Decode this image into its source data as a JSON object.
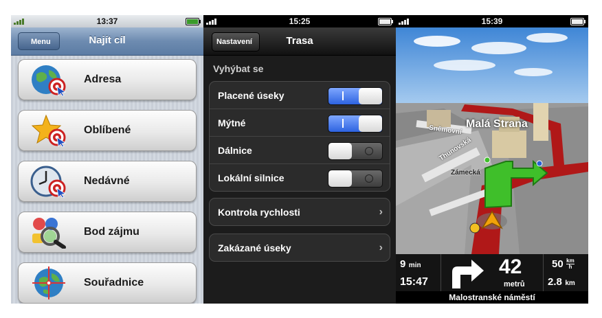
{
  "panel1": {
    "status_time": "13:37",
    "back_label": "Menu",
    "title": "Najít cíl",
    "items": [
      {
        "label": "Adresa",
        "icon": "globe-target-icon"
      },
      {
        "label": "Oblíbené",
        "icon": "star-target-icon"
      },
      {
        "label": "Nedávné",
        "icon": "clock-target-icon"
      },
      {
        "label": "Bod zájmu",
        "icon": "poi-magnifier-icon"
      },
      {
        "label": "Souřadnice",
        "icon": "globe-crosshair-icon"
      }
    ]
  },
  "panel2": {
    "status_time": "15:25",
    "back_label": "Nastavení",
    "title": "Trasa",
    "section": "Vyhýbat se",
    "toggles": [
      {
        "label": "Placené úseky",
        "state": "on"
      },
      {
        "label": "Mýtné",
        "state": "on"
      },
      {
        "label": "Dálnice",
        "state": "off"
      },
      {
        "label": "Lokální silnice",
        "state": "off"
      }
    ],
    "nav_rows": [
      {
        "label": "Kontrola rychlosti"
      },
      {
        "label": "Zakázané úseky"
      }
    ]
  },
  "panel3": {
    "status_time": "15:39",
    "map_labels": {
      "district": "Malá Strana",
      "street1": "Sněmovní",
      "street2": "Thunovská",
      "street3": "Zámecká"
    },
    "remaining_time": "9",
    "remaining_time_unit": "min",
    "arrival": "15:47",
    "distance_to_turn": "42",
    "distance_unit": "metrů",
    "speed": "50",
    "speed_unit_top": "km",
    "speed_unit_bottom": "h",
    "remaining_distance": "2.8",
    "remaining_distance_unit": "km",
    "current_street": "Malostranské náměstí"
  }
}
